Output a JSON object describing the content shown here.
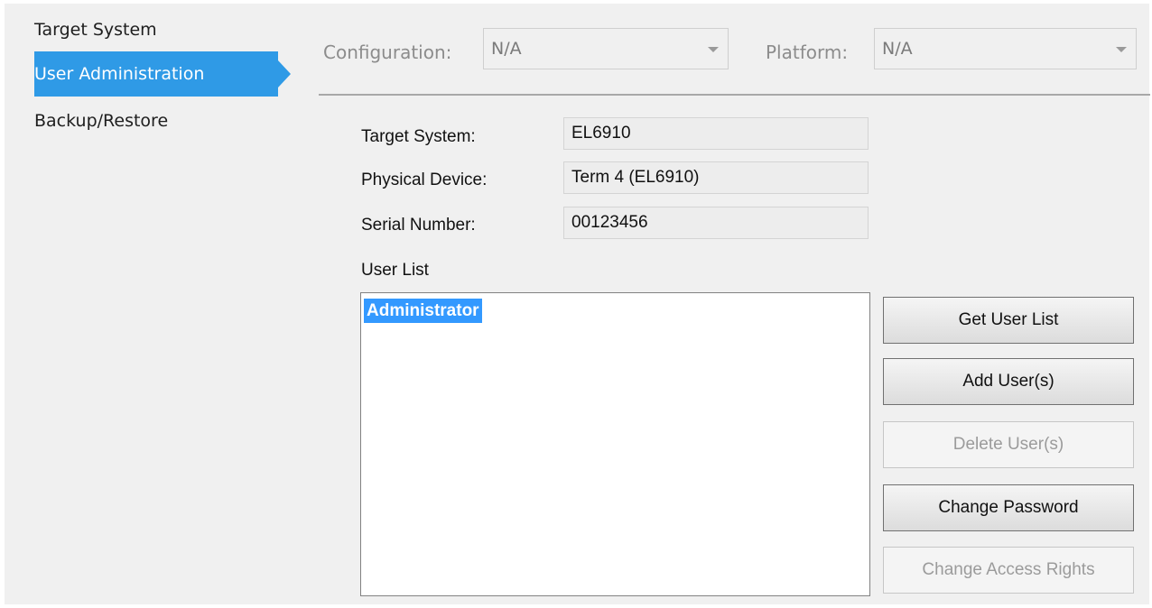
{
  "nav": {
    "items": [
      {
        "label": "Target System",
        "active": false
      },
      {
        "label": "User Administration",
        "active": true
      },
      {
        "label": "Backup/Restore",
        "active": false
      }
    ]
  },
  "config": {
    "configuration_label": "Configuration:",
    "configuration_value": "N/A",
    "platform_label": "Platform:",
    "platform_value": "N/A"
  },
  "info": {
    "target_system_label": "Target System:",
    "target_system_value": "EL6910",
    "physical_device_label": "Physical Device:",
    "physical_device_value": "Term 4 (EL6910)",
    "serial_number_label": "Serial Number:",
    "serial_number_value": "00123456"
  },
  "user_list": {
    "heading": "User List",
    "items": [
      "Administrator"
    ],
    "selected": "Administrator"
  },
  "buttons": {
    "get_user_list": {
      "label": "Get User List",
      "enabled": true
    },
    "add_users": {
      "label": "Add User(s)",
      "enabled": true
    },
    "delete_users": {
      "label": "Delete User(s)",
      "enabled": false
    },
    "change_password": {
      "label": "Change Password",
      "enabled": true
    },
    "change_access_rights": {
      "label": "Change Access Rights",
      "enabled": false
    }
  },
  "colors": {
    "accent": "#2f9ae6",
    "selection": "#3399ff",
    "background": "#f0f0f0"
  }
}
